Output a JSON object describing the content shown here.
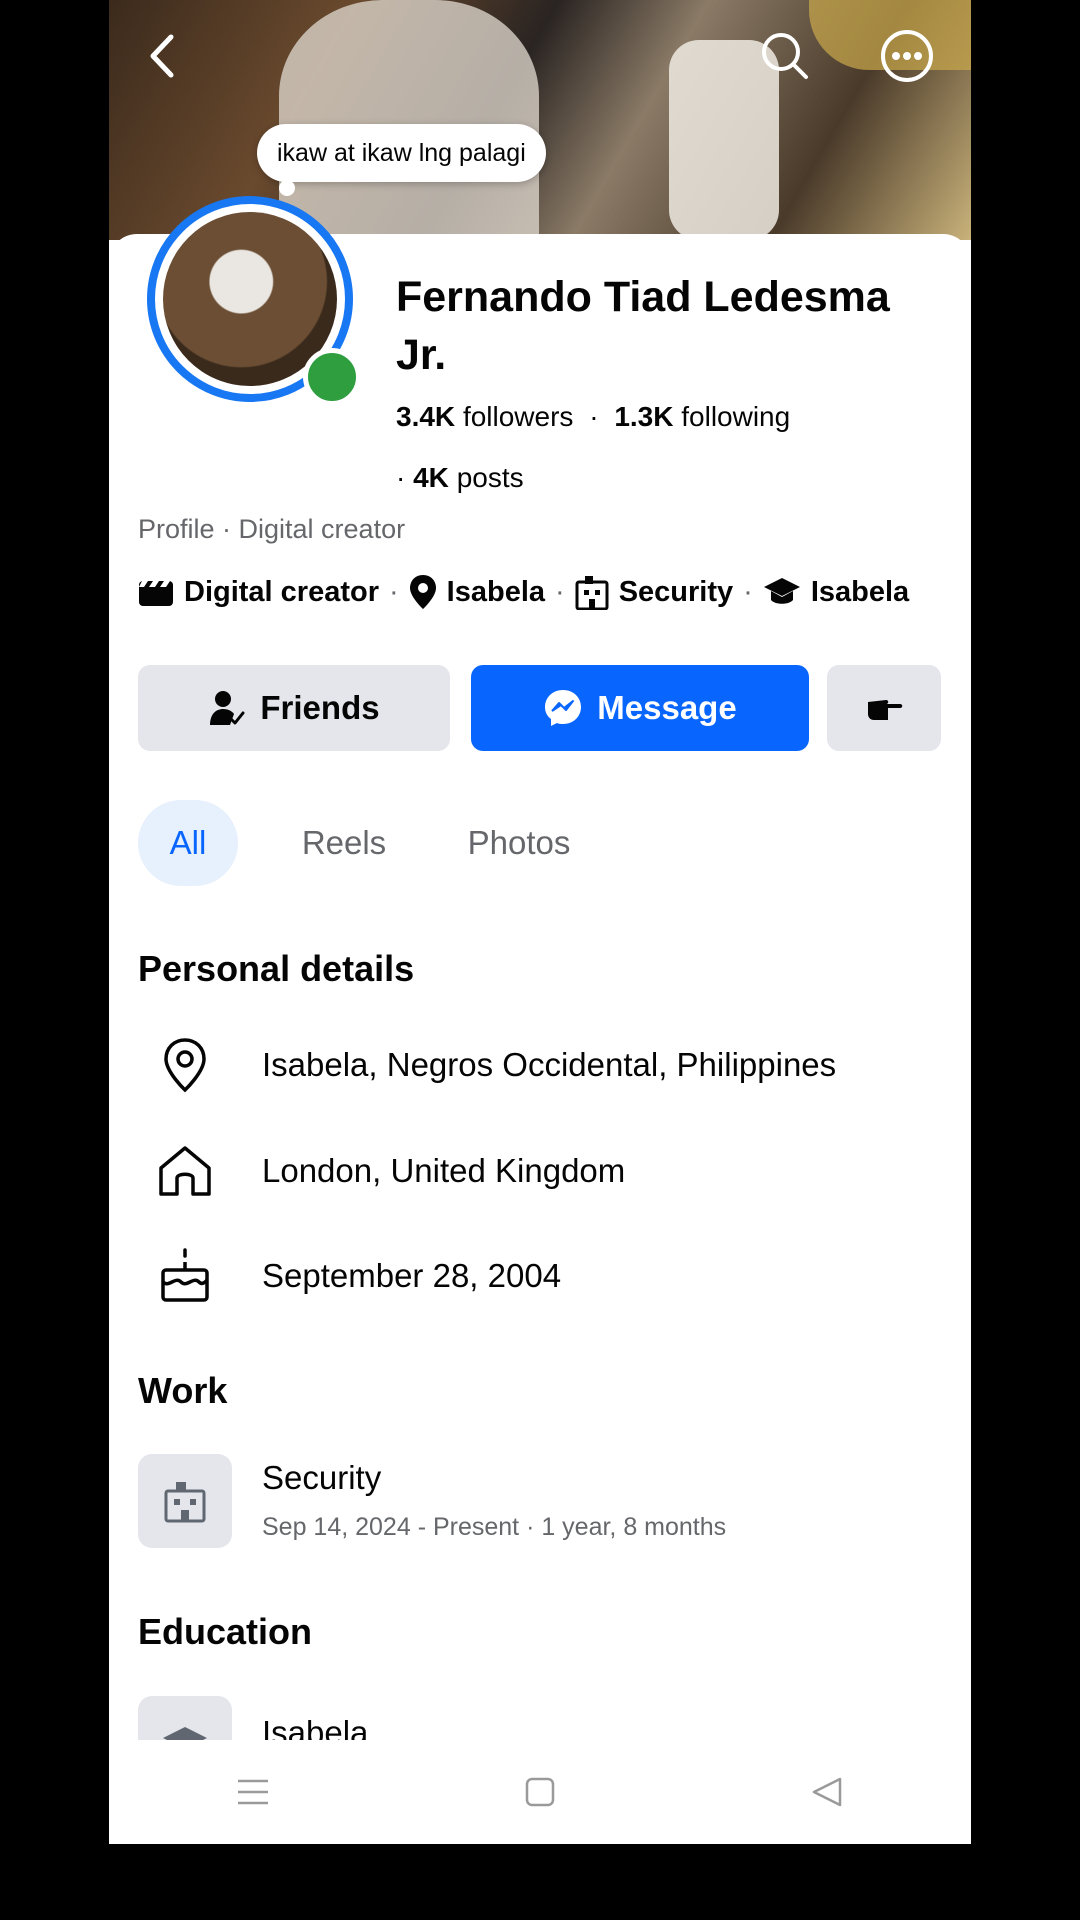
{
  "status_note": "ikaw at ikaw lng palagi",
  "profile": {
    "name": "Fernando Tiad Ledesma Jr.",
    "followers_count": "3.4K",
    "followers_label": "followers",
    "following_count": "1.3K",
    "following_label": "following",
    "posts_count": "4K",
    "posts_label": "posts",
    "subtitle": "Profile · Digital creator"
  },
  "chips": {
    "category": "Digital creator",
    "location": "Isabela",
    "work": "Security",
    "education": "Isabela"
  },
  "buttons": {
    "friends": "Friends",
    "message": "Message"
  },
  "tabs": [
    "All",
    "Reels",
    "Photos"
  ],
  "personal_details": {
    "heading": "Personal details",
    "current_city": "Isabela, Negros Occidental, Philippines",
    "hometown": "London, United Kingdom",
    "birthday": "September 28, 2004"
  },
  "work": {
    "heading": "Work",
    "title": "Security",
    "period": "Sep 14, 2024 - Present · 1 year, 8 months"
  },
  "education": {
    "heading": "Education",
    "school": "Isabela"
  },
  "colors": {
    "accent": "#0866ff",
    "online": "#2e9e3f",
    "tab_bg": "#e7f0fd",
    "button_grey": "#e4e6eb"
  }
}
